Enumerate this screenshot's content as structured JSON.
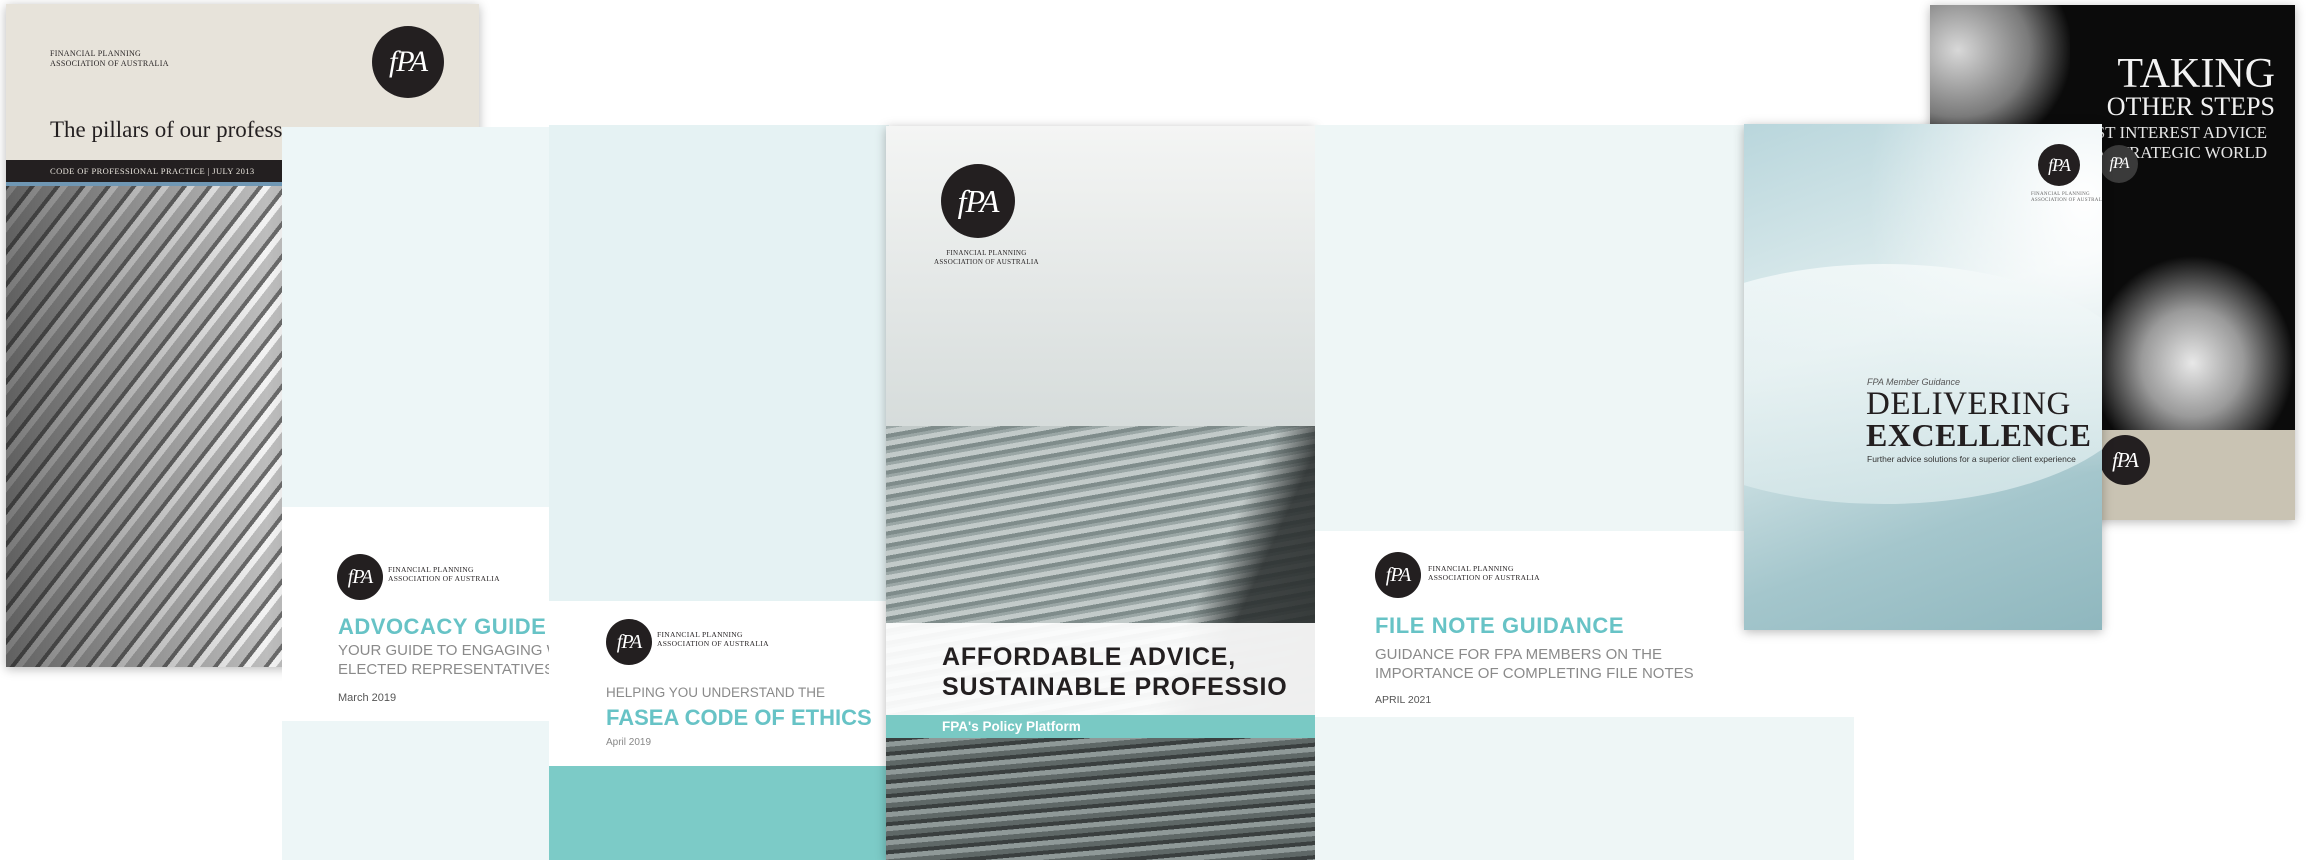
{
  "logo": {
    "mark": "fPA",
    "org_line1": "Financial Planning",
    "org_line2": "Association of Australia"
  },
  "documents": {
    "pillars": {
      "title": "The pillars of our profess",
      "band": "CODE OF PROFESSIONAL PRACTICE | JULY 2013"
    },
    "advocacy": {
      "title": "ADVOCACY GUIDE",
      "subtitle_line1": "YOUR GUIDE TO ENGAGING W",
      "subtitle_line2": "ELECTED REPRESENTATIVES",
      "date": "March 2019"
    },
    "fasea": {
      "kicker": "HELPING YOU UNDERSTAND THE",
      "title": "FASEA CODE OF ETHICS",
      "date": "April 2019"
    },
    "affordable": {
      "title_line1": "AFFORDABLE ADVICE,",
      "title_line2": "SUSTAINABLE PROFESSIO",
      "bar": "FPA's Policy Platform"
    },
    "filenote": {
      "title": "FILE NOTE GUIDANCE",
      "subtitle_line1": "GUIDANCE FOR FPA MEMBERS ON THE",
      "subtitle_line2": "IMPORTANCE OF COMPLETING FILE NOTES",
      "date": "APRIL 2021"
    },
    "taking": {
      "title_line1": "TAKING",
      "title_line2": "OTHER STEPS",
      "subtitle_line1": "EST INTEREST ADVICE",
      "subtitle_line2": "a STRATEGIC WORLD"
    },
    "delivering": {
      "kicker": "FPA Member Guidance",
      "title_line1": "DELIVERING",
      "title_line2": "EXCELLENCE",
      "subtitle": "Further advice solutions for a superior client experience"
    }
  },
  "colors": {
    "teal": "#67c3c6",
    "teal_bar": "#79c9c4",
    "dark": "#231f20"
  }
}
